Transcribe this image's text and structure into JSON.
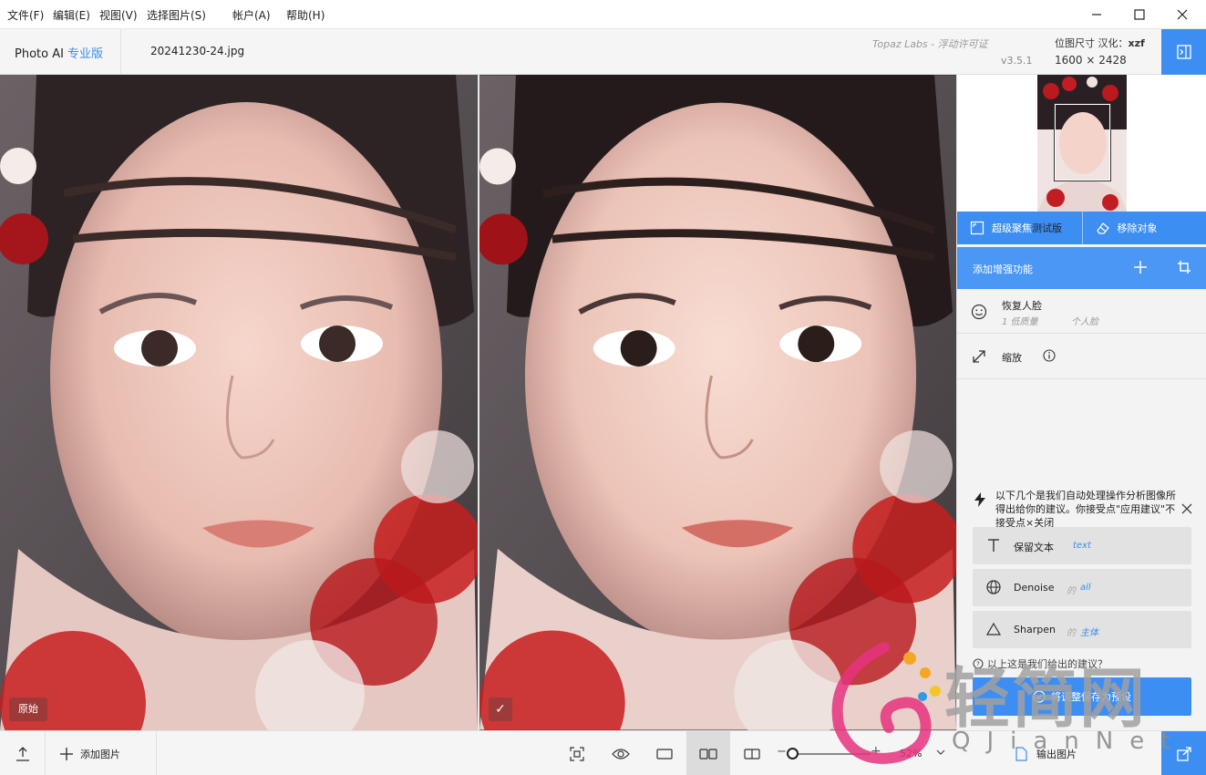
{
  "menu": {
    "items": [
      "文件(F)",
      "编辑(E)",
      "视图(V)",
      "选择图片(S)",
      "帐户(A)",
      "帮助(H)"
    ]
  },
  "header": {
    "app_name": "Photo AI",
    "edition": "专业版",
    "filename": "20241230-24.jpg",
    "license": "Topaz Labs - 浮动许可证",
    "version": "v3.5.1",
    "dim_label": "位图尺寸 汉化：",
    "dim_author": "xzf",
    "dim_value": "1600 × 2428"
  },
  "viewer": {
    "original_tag": "原始",
    "processed_tag": "✓"
  },
  "panel": {
    "feature_focus": "超级聚焦",
    "feature_focus_beta": "测试版",
    "feature_remove": "移除对象",
    "add_enhance": "添加增强功能",
    "face_title": "恢复人脸",
    "face_sub1": "1 低质量",
    "face_sub2": "个人脸",
    "scale_title": "缩放",
    "suggest_text": "以下几个是我们自动处理操作分析图像所得出给你的建议。你接受点\"应用建议\"不接受点×关闭",
    "suggestions": [
      {
        "label": "保留文本",
        "of": "",
        "value": "text"
      },
      {
        "label": "Denoise",
        "of": "的",
        "value": "all"
      },
      {
        "label": "Sharpen",
        "of": "的",
        "value": "主体"
      }
    ],
    "question": "以上这是我们给出的建议？",
    "apply_label": "将调整保存为预设"
  },
  "bottom": {
    "add_image": "添加图片",
    "zoom": "52%",
    "zoom_level": 0.05,
    "export": "输出图片"
  },
  "watermark": {
    "big": "轻简网",
    "small": "QJianNet"
  },
  "colors": {
    "accent": "#3d8ef3",
    "edition": "#3a8ee6"
  }
}
